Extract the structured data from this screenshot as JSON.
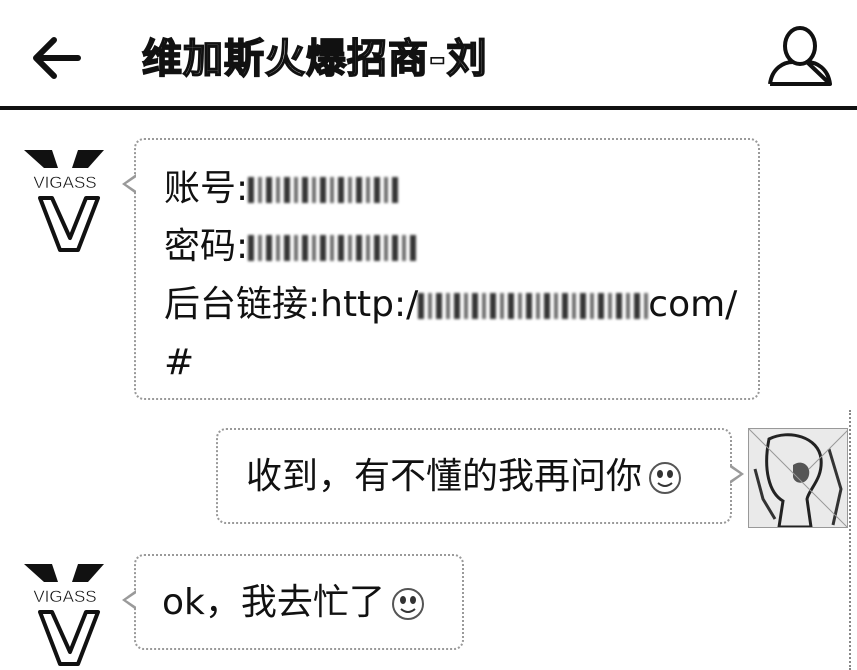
{
  "header": {
    "title": "维加斯火爆招商-刘",
    "back_icon": "back-arrow-icon",
    "profile_icon": "person-icon"
  },
  "messages": [
    {
      "sender": "contact",
      "lines": [
        {
          "label": "账号:",
          "redacted": true
        },
        {
          "label": "密码:",
          "redacted": true
        },
        {
          "label": "后台链接:http:/",
          "redacted": true,
          "suffix": "com/"
        },
        {
          "label": "#",
          "redacted": false
        }
      ]
    },
    {
      "sender": "me",
      "text": "收到，有不懂的我再问你",
      "emoji": "smiley-icon"
    },
    {
      "sender": "contact",
      "text": "ok，我去忙了",
      "emoji": "smiley-icon"
    }
  ],
  "contact_avatar": {
    "brand": "VIGASS"
  },
  "colors": {
    "text": "#111111",
    "bubble_border": "#9a9a9a",
    "background": "#ffffff"
  }
}
